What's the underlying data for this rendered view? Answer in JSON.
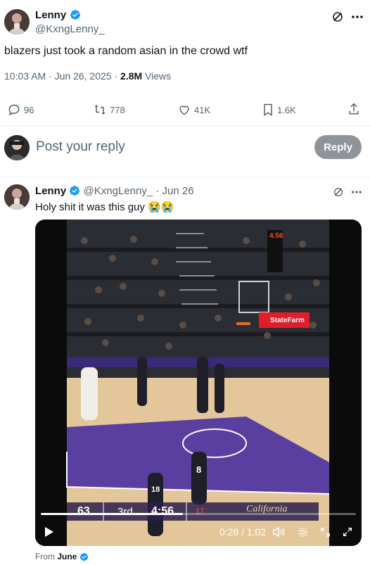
{
  "tweet": {
    "author_name": "Lenny",
    "author_handle": "@KxngLenny_",
    "text": "blazers just took a random asian in the crowd wtf",
    "time": "10:03 AM",
    "date": "Jun 26, 2025",
    "views_count": "2.8M",
    "views_label": "Views",
    "replies": "96",
    "retweets": "778",
    "likes": "41K",
    "bookmarks": "1.6K"
  },
  "compose": {
    "placeholder": "Post your reply",
    "reply_label": "Reply"
  },
  "reply_tweet": {
    "author_name": "Lenny",
    "author_handle": "@KxngLenny_",
    "date": "· Jun 26",
    "text": "Holy shit it was this guy 😭😭",
    "video": {
      "scoreboard_home": "63",
      "scoreboard_quarter": "3rd",
      "scoreboard_clock": "4:56",
      "scoreboard_shot": "17",
      "shot_clock_sign": "4.56",
      "sponsor_sign": "StateFarm",
      "brand_overlay": "California",
      "player_jersey": "8",
      "ref_jersey": "18",
      "elapsed": "0:28",
      "duration": "1:02",
      "progress": 0.45
    },
    "from_label": "From",
    "from_source": "June"
  },
  "colors": {
    "verified": "#1d9bf0",
    "court_purple": "#5b3fa0",
    "statefarm_red": "#e01e2b"
  }
}
